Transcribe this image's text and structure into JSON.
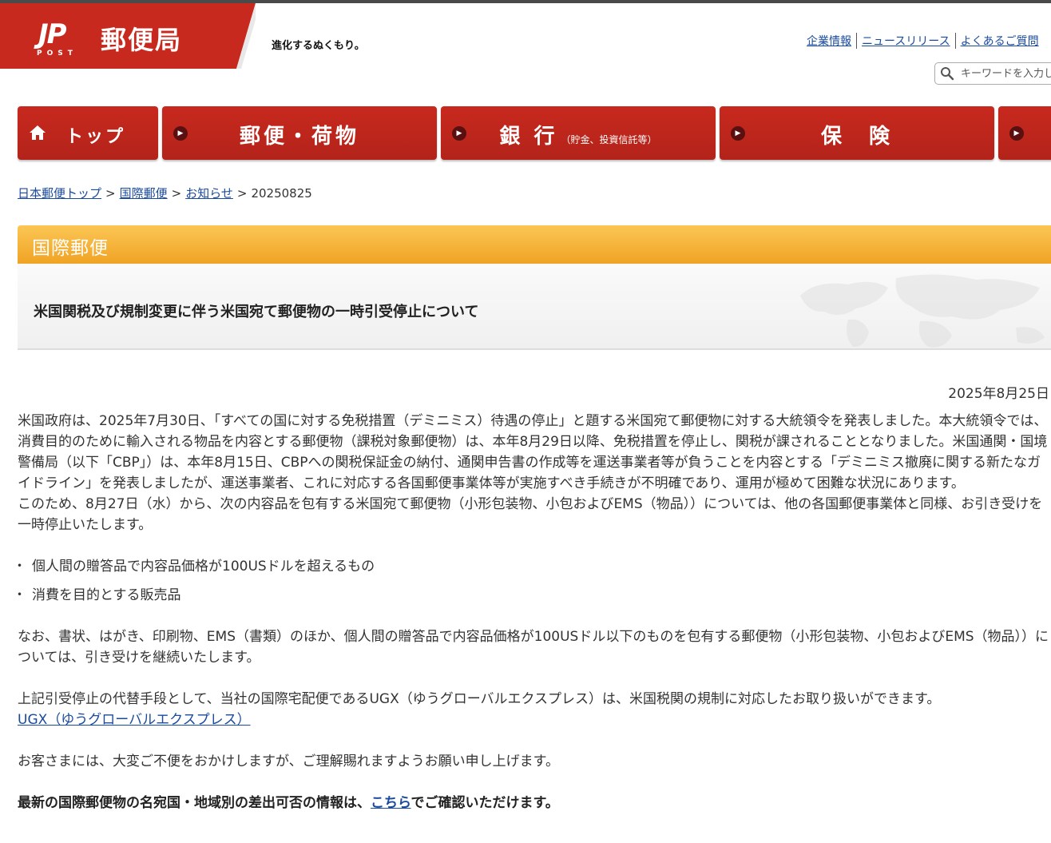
{
  "header": {
    "logo_mark": "JP",
    "logo_post": "POST",
    "logo_name": "郵便局",
    "tagline": "進化するぬくもり。",
    "util_links": [
      "企業情報",
      "ニュースリリース",
      "よくあるご質問"
    ],
    "search_placeholder": "キーワードを入力し",
    "brand_red": "#c8291e"
  },
  "gnav": {
    "top": "トップ",
    "mail": "郵便・荷物",
    "bank": "銀 行",
    "bank_sub": "（貯金、投資信託等）",
    "insurance": "保　険"
  },
  "breadcrumb": {
    "items": [
      "日本郵便トップ",
      "国際郵便",
      "お知らせ"
    ],
    "current": "20250825"
  },
  "section": {
    "label": "国際郵便",
    "title": "米国関税及び規制変更に伴う米国宛て郵便物の一時引受停止について",
    "accent": "#f0a325"
  },
  "article": {
    "date": "2025年8月25日",
    "para1": "米国政府は、2025年7月30日、「すべての国に対する免税措置（デミニミス）待遇の停止」と題する米国宛て郵便物に対する大統領令を発表しました。本大統領令では、消費目的のために輸入される物品を内容とする郵便物（課税対象郵便物）は、本年8月29日以降、免税措置を停止し、関税が課されることとなりました。米国通関・国境警備局（以下「CBP」）は、本年8月15日、CBPへの関税保証金の納付、通関申告書の作成等を運送事業者等が負うことを内容とする「デミニミス撤廃に関する新たなガイドライン」を発表しましたが、運送事業者、これに対応する各国郵便事業体等が実施すべき手続きが不明確であり、運用が極めて困難な状況にあります。",
    "para2": "このため、8月27日（水）から、次の内容品を包有する米国宛て郵便物（小形包装物、小包およびEMS（物品））については、他の各国郵便事業体と同様、お引き受けを一時停止いたします。",
    "bullets": [
      "個人間の贈答品で内容品価格が100USドルを超えるもの",
      "消費を目的とする販売品"
    ],
    "para3": "なお、書状、はがき、印刷物、EMS（書類）のほか、個人間の贈答品で内容品価格が100USドル以下のものを包有する郵便物（小形包装物、小包およびEMS（物品））については、引き受けを継続いたします。",
    "para4": "上記引受停止の代替手段として、当社の国際宅配便であるUGX（ゆうグローバルエクスプレス）は、米国税関の規制に対応したお取り扱いができます。",
    "ugx_link": "UGX（ゆうグローバルエクスプレス）",
    "para5": "お客さまには、大変ご不便をおかけしますが、ご理解賜れますようお願い申し上げます。",
    "final_before": "最新の国際郵便物の名宛国・地域別の差出可否の情報は、",
    "final_link": "こちら",
    "final_after": "でご確認いただけます。"
  }
}
